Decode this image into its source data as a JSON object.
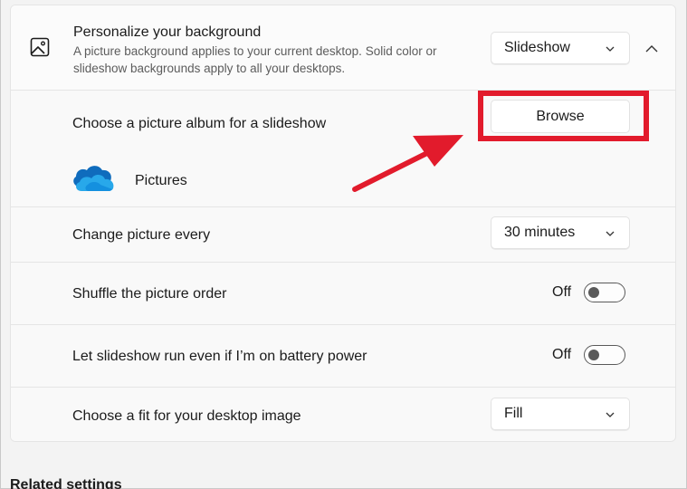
{
  "header": {
    "title": "Personalize your background",
    "description": "A picture background applies to your current desktop. Solid color or slideshow backgrounds apply to all your desktops.",
    "mode_dropdown": "Slideshow",
    "icon": "image-icon"
  },
  "album": {
    "label": "Choose a picture album for a slideshow",
    "browse_label": "Browse",
    "folder_name": "Pictures",
    "folder_icon": "onedrive-cloud-icon"
  },
  "interval": {
    "label": "Change picture every",
    "value": "30 minutes"
  },
  "shuffle": {
    "label": "Shuffle the picture order",
    "state": "Off"
  },
  "battery": {
    "label": "Let slideshow run even if I’m on battery power",
    "state": "Off"
  },
  "fit": {
    "label": "Choose a fit for your desktop image",
    "value": "Fill"
  },
  "related": {
    "heading": "Related settings"
  },
  "colors": {
    "annotation_red": "#e21b2c",
    "onedrive_blue": "#0f6cbd"
  }
}
